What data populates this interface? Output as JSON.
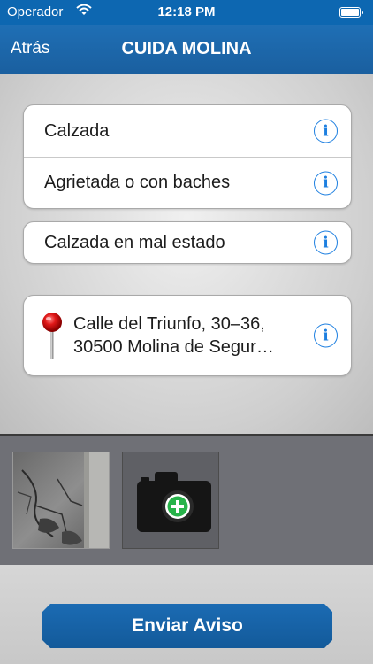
{
  "status_bar": {
    "carrier": "Operador",
    "time": "12:18 PM"
  },
  "nav": {
    "back_label": "Atrás",
    "title": "CUIDA MOLINA"
  },
  "form": {
    "category": "Calzada",
    "subcategory": "Agrietada o con baches",
    "description": "Calzada en mal estado",
    "address_line1": "Calle del Triunfo, 30–36,",
    "address_line2": "30500 Molina de Segur…",
    "info_glyph": "i"
  },
  "actions": {
    "send_label": "Enviar Aviso"
  },
  "colors": {
    "brand_blue": "#1a63a8",
    "info_blue": "#1d7fe0",
    "add_green": "#27b34a"
  }
}
